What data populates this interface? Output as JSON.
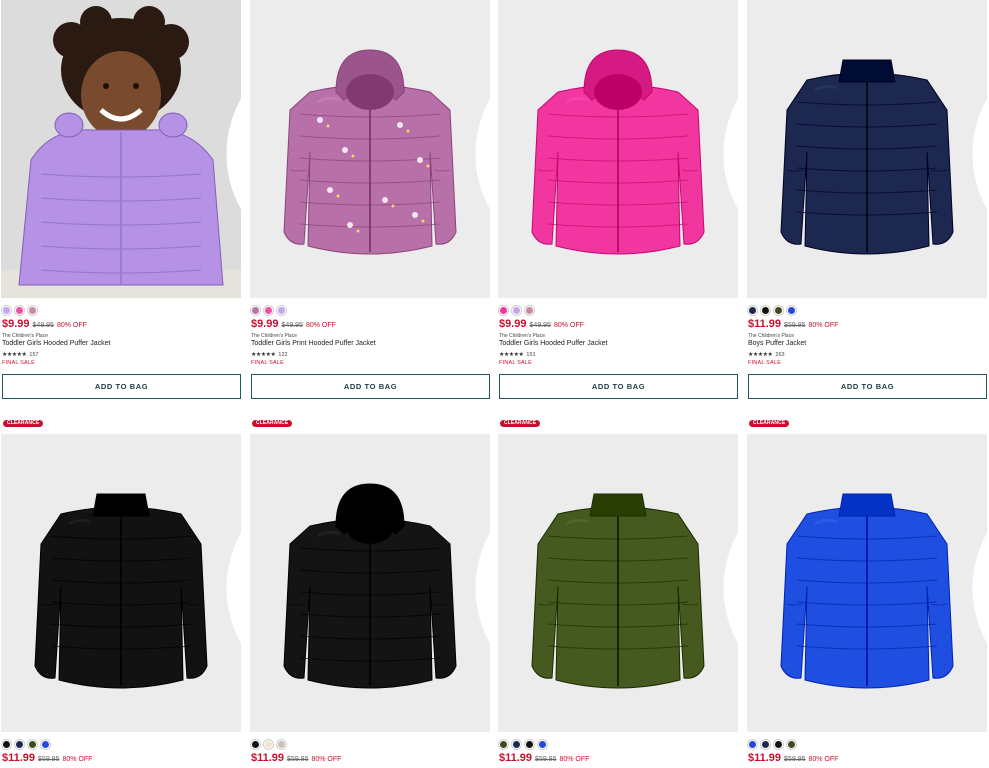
{
  "colors": {
    "sale_red": "#c8102e",
    "button_border": "#1d5a5e",
    "image_bg": "#ececec"
  },
  "products": [
    {
      "id": "p1",
      "jacket_color": "#b592e6",
      "illustration": "toddler-model-lilac",
      "swatches": [
        "#c7a6f0",
        "#ef4fa5",
        "#c58aa8"
      ],
      "price": "$9.99",
      "original_price": "$49.95",
      "discount": "80% OFF",
      "brand": "The Children's Place",
      "name": "Toddler Girls Hooded Puffer Jacket",
      "rating_count": "157",
      "final_sale": "FINAL SALE",
      "cta": "ADD TO BAG"
    },
    {
      "id": "p2",
      "jacket_color": "#b870a8",
      "illustration": "hooded-print",
      "swatches": [
        "#b475a4",
        "#ef4fa5",
        "#c7a6f0"
      ],
      "price": "$9.99",
      "original_price": "$49.95",
      "discount": "80% OFF",
      "brand": "The Children's Place",
      "name": "Toddler Girls Print Hooded Puffer Jacket",
      "rating_count": "122",
      "final_sale": "FINAL SALE",
      "cta": "ADD TO BAG"
    },
    {
      "id": "p3",
      "jacket_color": "#f2369f",
      "illustration": "hooded",
      "swatches": [
        "#f2369f",
        "#c7a6f0",
        "#c58aa8"
      ],
      "price": "$9.99",
      "original_price": "$49.95",
      "discount": "80% OFF",
      "brand": "The Children's Place",
      "name": "Toddler Girls Hooded Puffer Jacket",
      "rating_count": "151",
      "final_sale": "FINAL SALE",
      "cta": "ADD TO BAG"
    },
    {
      "id": "p4",
      "jacket_color": "#1c2850",
      "illustration": "collar",
      "swatches": [
        "#1c2850",
        "#111111",
        "#3f4e1d",
        "#2549d8"
      ],
      "price": "$11.99",
      "original_price": "$59.95",
      "discount": "80% OFF",
      "brand": "The Children's Place",
      "name": "Boys Puffer Jacket",
      "rating_count": "263",
      "final_sale": "FINAL SALE",
      "cta": "ADD TO BAG"
    },
    {
      "id": "p5",
      "badge": "CLEARANCE",
      "jacket_color": "#121212",
      "illustration": "collar",
      "swatches": [
        "#111111",
        "#1c2850",
        "#3f4e1d",
        "#2549d8"
      ],
      "price": "$11.99",
      "original_price": "$59.95",
      "discount": "80% OFF"
    },
    {
      "id": "p6",
      "badge": "CLEARANCE",
      "jacket_color": "#141414",
      "illustration": "hooded",
      "swatches": [
        "#111111",
        "#efe3d2",
        "#cdbfb6"
      ],
      "price": "$11.99",
      "original_price": "$59.95",
      "discount": "80% OFF"
    },
    {
      "id": "p7",
      "badge": "CLEARANCE",
      "jacket_color": "#465a1f",
      "illustration": "collar",
      "swatches": [
        "#3f4e1d",
        "#1c2850",
        "#111111",
        "#2549d8"
      ],
      "price": "$11.99",
      "original_price": "$59.95",
      "discount": "80% OFF"
    },
    {
      "id": "p8",
      "badge": "CLEARANCE",
      "jacket_color": "#1f4fe0",
      "illustration": "collar",
      "swatches": [
        "#2549d8",
        "#1c2850",
        "#111111",
        "#3f4e1d"
      ],
      "price": "$11.99",
      "original_price": "$59.95",
      "discount": "80% OFF"
    }
  ]
}
